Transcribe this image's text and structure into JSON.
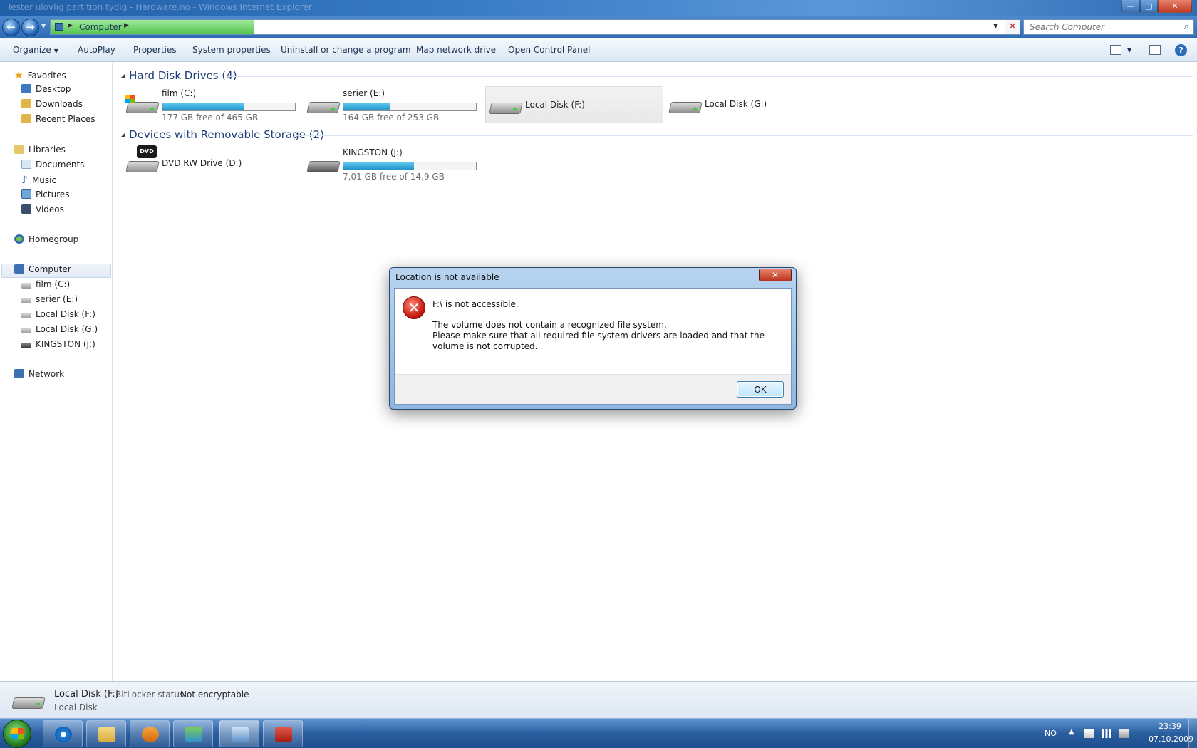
{
  "window": {
    "title": "Tester ulovlig partition tydig - Hardware.no - Windows Internet Explorer",
    "controls": {
      "minimize": "—",
      "maximize": "□",
      "close": "✕"
    }
  },
  "address": {
    "breadcrumb": "Computer",
    "load_progress": 0.21,
    "stop_glyph": "✕",
    "search_placeholder": "Search Computer"
  },
  "commands": {
    "organize": "Organize",
    "autoplay": "AutoPlay",
    "properties": "Properties",
    "system_properties": "System properties",
    "uninstall": "Uninstall or change a program",
    "map_drive": "Map network drive",
    "control_panel": "Open Control Panel",
    "help": "?"
  },
  "nav": {
    "favorites": "Favorites",
    "desktop": "Desktop",
    "downloads": "Downloads",
    "recent": "Recent Places",
    "libraries": "Libraries",
    "documents": "Documents",
    "music": "Music",
    "pictures": "Pictures",
    "videos": "Videos",
    "homegroup": "Homegroup",
    "computer": "Computer",
    "drive_c": "film (C:)",
    "drive_e": "serier (E:)",
    "drive_f": "Local Disk (F:)",
    "drive_g": "Local Disk (G:)",
    "drive_j": "KINGSTON (J:)",
    "network": "Network"
  },
  "content": {
    "hdd_group": "Hard Disk Drives (4)",
    "removable_group": "Devices with Removable Storage (2)",
    "drives": {
      "c": {
        "name": "film (C:)",
        "free": "177 GB free of 465 GB",
        "used_fraction": 0.62
      },
      "e": {
        "name": "serier (E:)",
        "free": "164 GB free of 253 GB",
        "used_fraction": 0.35
      },
      "f": {
        "name": "Local Disk (F:)"
      },
      "g": {
        "name": "Local Disk (G:)"
      },
      "d": {
        "name": "DVD RW Drive (D:)",
        "badge": "DVD"
      },
      "j": {
        "name": "KINGSTON (J:)",
        "free": "7,01 GB free of 14,9 GB",
        "used_fraction": 0.53
      }
    }
  },
  "details": {
    "name": "Local Disk (F:)",
    "bitlocker_label": "BitLocker status:",
    "bitlocker_value": "Not encryptable",
    "type": "Local Disk"
  },
  "dialog": {
    "title": "Location is not available",
    "close": "✕",
    "error_glyph": "✕",
    "main": "F:\\ is not accessible.",
    "line1": "The volume does not contain a recognized file system.",
    "line2": "Please make sure that all required file system drivers are loaded and that the volume is not corrupted.",
    "ok": "OK"
  },
  "tray": {
    "lang": "NO",
    "show_hidden": "▲",
    "time": "23:39",
    "date": "07.10.2009"
  },
  "colors": {
    "usage_bar": "#1f95c9",
    "error_red": "#c6180f",
    "group_header": "#1e3f7a"
  }
}
